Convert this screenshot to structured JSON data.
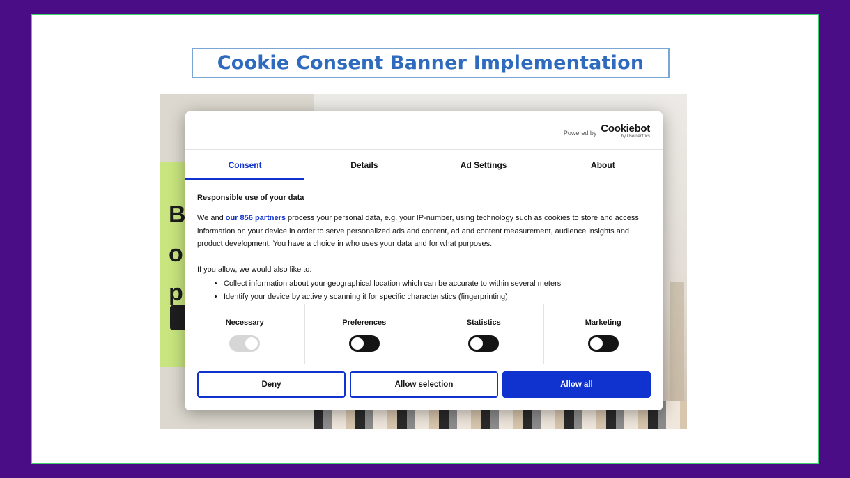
{
  "slide": {
    "title": "Cookie Consent Banner Implementation"
  },
  "background_site": {
    "letters": [
      "B",
      "o",
      "p"
    ]
  },
  "dialog": {
    "powered_by": "Powered by",
    "brand": "Cookiebot",
    "brand_sub": "by Usercentrics",
    "tabs": [
      {
        "label": "Consent",
        "active": true
      },
      {
        "label": "Details",
        "active": false
      },
      {
        "label": "Ad Settings",
        "active": false
      },
      {
        "label": "About",
        "active": false
      }
    ],
    "heading": "Responsible use of your data",
    "para_prefix": "We and ",
    "partners_link": "our 856 partners",
    "para_suffix": " process your personal data, e.g. your IP-number, using technology such as cookies to store and access information on your device in order to serve personalized ads and content, ad and content measurement, audience insights and product development. You have a choice in who uses your data and for what purposes.",
    "allow_intro": "If you allow, we would also like to:",
    "bullets": [
      "Collect information about your geographical location which can be accurate to within several meters",
      "Identify your device by actively scanning it for specific characteristics (fingerprinting)"
    ],
    "toggles": [
      {
        "label": "Necessary",
        "state": "on",
        "disabled": true
      },
      {
        "label": "Preferences",
        "state": "off",
        "disabled": false
      },
      {
        "label": "Statistics",
        "state": "off",
        "disabled": false
      },
      {
        "label": "Marketing",
        "state": "off",
        "disabled": false
      }
    ],
    "buttons": {
      "deny": "Deny",
      "allow_selection": "Allow selection",
      "allow_all": "Allow all"
    },
    "colors": {
      "accent": "#1032cf",
      "frame_border": "#3fd070",
      "page_bg": "#4b0d86",
      "title_color": "#2e6bbf"
    }
  }
}
